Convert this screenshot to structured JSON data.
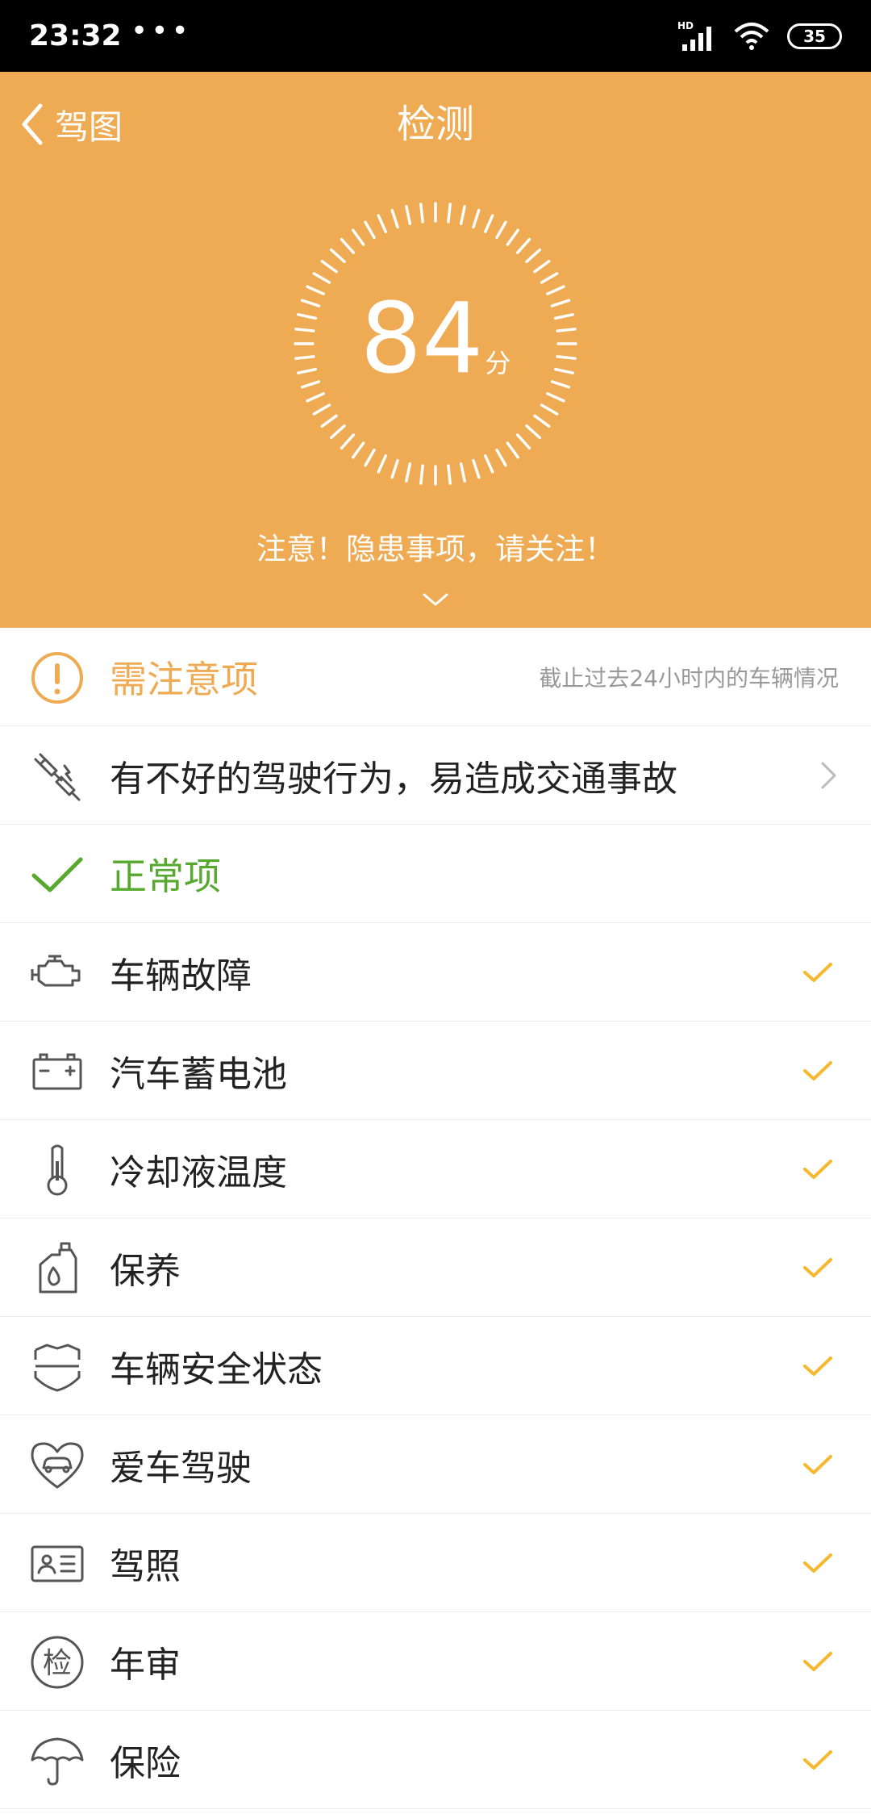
{
  "status_bar": {
    "time": "23:32",
    "dots": "•••",
    "network": "HD",
    "battery": "35"
  },
  "header": {
    "back_label": "驾图",
    "title": "检测",
    "score": "84",
    "score_unit": "分",
    "alert": "注意！隐患事项，请关注！",
    "background_color": "#EEAB53"
  },
  "warning_section": {
    "title": "需注意项",
    "note": "截止过去24小时内的车辆情况",
    "color": "#EEAB53",
    "items": [
      {
        "label": "有不好的驾驶行为，易造成交通事故",
        "icon": "driving-behavior-icon"
      }
    ]
  },
  "normal_section": {
    "title": "正常项",
    "color": "#56A82E",
    "check_color": "#F5B82E",
    "items": [
      {
        "label": "车辆故障",
        "icon": "engine-icon"
      },
      {
        "label": "汽车蓄电池",
        "icon": "battery-icon"
      },
      {
        "label": "冷却液温度",
        "icon": "thermometer-icon"
      },
      {
        "label": "保养",
        "icon": "oil-bottle-icon"
      },
      {
        "label": "车辆安全状态",
        "icon": "shield-icon"
      },
      {
        "label": "爱车驾驶",
        "icon": "heart-car-icon"
      },
      {
        "label": "驾照",
        "icon": "id-card-icon"
      },
      {
        "label": "年审",
        "icon": "inspection-badge-icon",
        "glyph": "检"
      },
      {
        "label": "保险",
        "icon": "umbrella-icon"
      }
    ]
  }
}
